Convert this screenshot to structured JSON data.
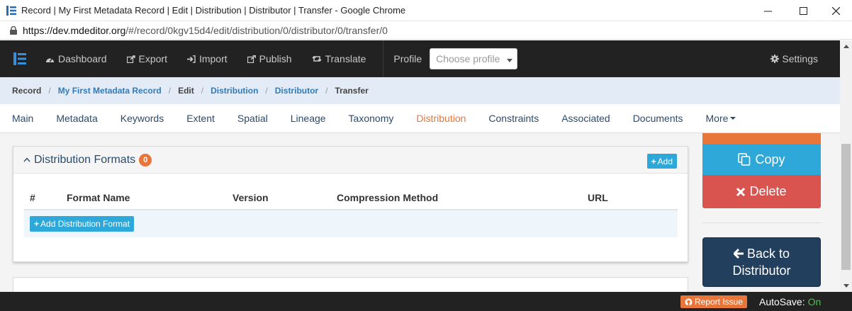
{
  "window": {
    "title": "Record | My First Metadata Record | Edit | Distribution | Distributor | Transfer - Google Chrome",
    "url_host": "https://dev.mdeditor.org",
    "url_path": "/#/record/0kgv15d4/edit/distribution/0/distributor/0/transfer/0"
  },
  "navbar": {
    "items": [
      {
        "label": "Dashboard",
        "icon": "tachometer-icon"
      },
      {
        "label": "Export",
        "icon": "share-square-icon"
      },
      {
        "label": "Import",
        "icon": "sign-in-icon"
      },
      {
        "label": "Publish",
        "icon": "external-link-icon"
      },
      {
        "label": "Translate",
        "icon": "retweet-icon"
      }
    ],
    "profile_label": "Profile",
    "profile_placeholder": "Choose profile",
    "settings_label": "Settings"
  },
  "breadcrumb": {
    "items": [
      "Record",
      "My First Metadata Record",
      "Edit",
      "Distribution",
      "Distributor",
      "Transfer"
    ]
  },
  "tabs": {
    "items": [
      "Main",
      "Metadata",
      "Keywords",
      "Extent",
      "Spatial",
      "Lineage",
      "Taxonomy",
      "Distribution",
      "Constraints",
      "Associated",
      "Documents"
    ],
    "active": "Distribution",
    "more_label": "More"
  },
  "panel": {
    "title": "Distribution Formats",
    "count": "0",
    "add_label": "Add",
    "columns": [
      "#",
      "Format Name",
      "Version",
      "Compression Method",
      "URL"
    ],
    "add_format_label": "Add Distribution Format"
  },
  "sidebar": {
    "copy_label": "Copy",
    "delete_label": "Delete",
    "back_line1": "Back to",
    "back_line2": "Distributor"
  },
  "footer": {
    "report_label": "Report Issue",
    "autosave_label": "AutoSave:",
    "autosave_value": "On"
  },
  "colors": {
    "accent_orange": "#e8753a",
    "info_blue": "#2ea8d8",
    "danger_red": "#d9534f",
    "navy": "#22405e",
    "navbar_dark": "#222222"
  }
}
